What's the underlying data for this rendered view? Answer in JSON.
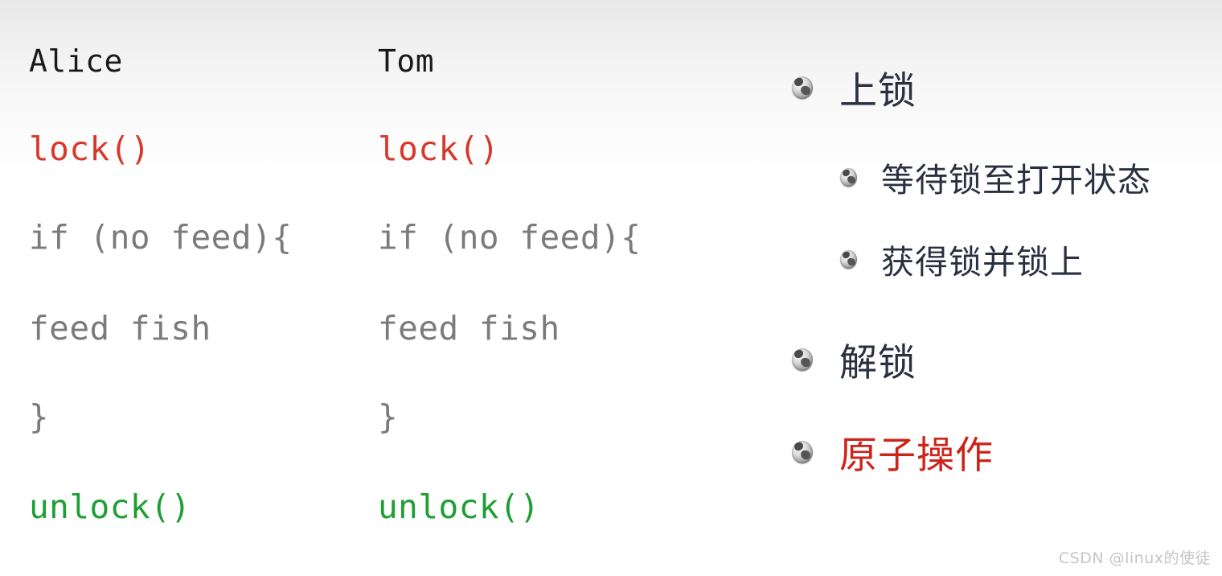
{
  "slide": {
    "background_top": "#e8e8e8",
    "background_bottom": "#ffffff"
  },
  "colors": {
    "lock_red": "#d6392c",
    "unlock_green": "#1e9e33",
    "code_gray": "#7b7b7b",
    "title_black": "#1a1a1a",
    "bullet_text": "#2b3040",
    "accent_red": "#cc2418",
    "watermark_gray": "#c6c6c6"
  },
  "columns": [
    {
      "name": "alice",
      "title": "Alice",
      "lines": [
        {
          "text": "lock()",
          "style": "red"
        },
        {
          "text": "if (no feed){",
          "style": "gray"
        },
        {
          "text": "feed fish",
          "style": "gray"
        },
        {
          "text": "}",
          "style": "gray"
        },
        {
          "text": "unlock()",
          "style": "green"
        }
      ]
    },
    {
      "name": "tom",
      "title": "Tom",
      "lines": [
        {
          "text": "lock()",
          "style": "red"
        },
        {
          "text": "if (no feed){",
          "style": "gray"
        },
        {
          "text": "feed fish",
          "style": "gray"
        },
        {
          "text": "}",
          "style": "gray"
        },
        {
          "text": "unlock()",
          "style": "green"
        }
      ]
    }
  ],
  "bullets": {
    "marker_icon": "globe-bullet-icon",
    "items": [
      {
        "level": 1,
        "text": "上锁",
        "accent": false
      },
      {
        "level": 2,
        "text": "等待锁至打开状态",
        "accent": false
      },
      {
        "level": 2,
        "text": "获得锁并锁上",
        "accent": false
      },
      {
        "level": 1,
        "text": "解锁",
        "accent": false
      },
      {
        "level": 1,
        "text": "原子操作",
        "accent": true
      }
    ]
  },
  "watermark": {
    "text": "CSDN @linux的使徒"
  }
}
